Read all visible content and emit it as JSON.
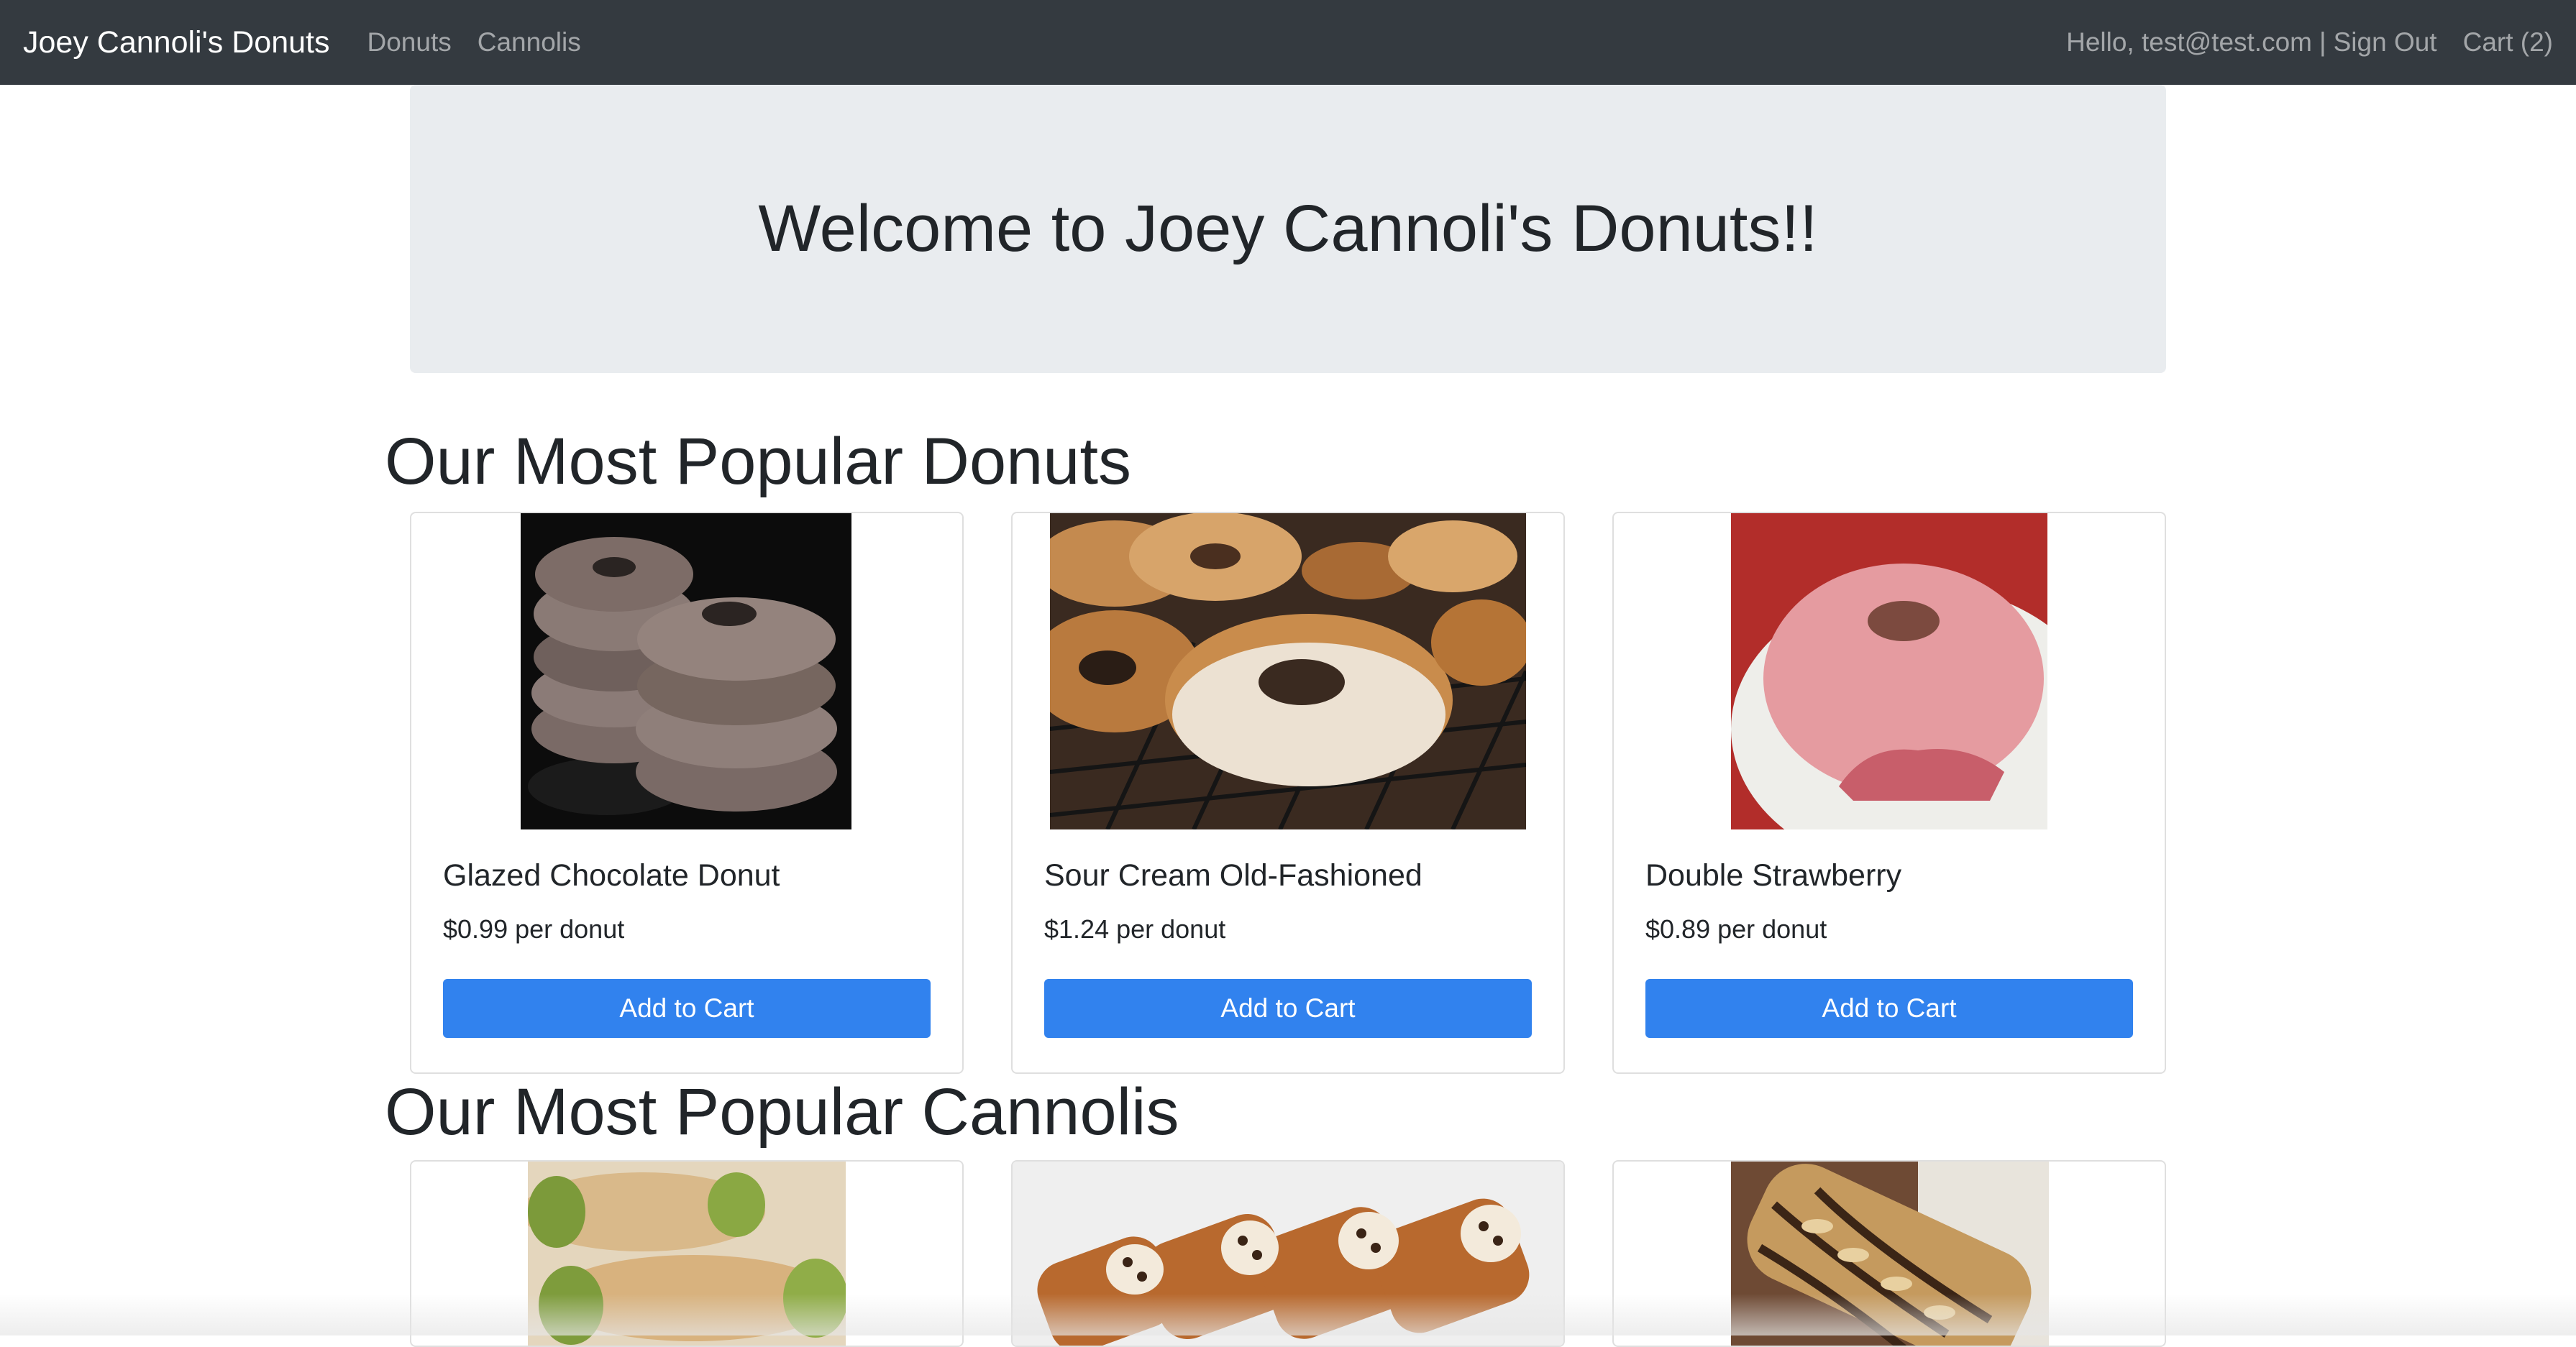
{
  "navbar": {
    "brand": "Joey Cannoli's Donuts",
    "links": [
      "Donuts",
      "Cannolis"
    ],
    "greeting": "Hello, test@test.com",
    "separator": "|",
    "sign_out": "Sign Out",
    "cart": "Cart (2)"
  },
  "jumbotron": {
    "heading": "Welcome to Joey Cannoli's Donuts!!"
  },
  "donuts": {
    "title": "Our Most Popular Donuts",
    "items": [
      {
        "name": "Glazed Chocolate Donut",
        "price": "$0.99 per donut",
        "button": "Add to Cart",
        "image": "chocolate-donut-stack-photo"
      },
      {
        "name": "Sour Cream Old-Fashioned",
        "price": "$1.24 per donut",
        "button": "Add to Cart",
        "image": "old-fashioned-donuts-on-rack-photo"
      },
      {
        "name": "Double Strawberry",
        "price": "$0.89 per donut",
        "button": "Add to Cart",
        "image": "strawberry-donut-bitten-photo"
      }
    ]
  },
  "cannolis": {
    "title": "Our Most Popular Cannolis",
    "items": [
      {
        "image": "pistachio-cannoli-photo"
      },
      {
        "image": "chocolate-chip-cannolis-photo"
      },
      {
        "image": "almond-chocolate-cannoli-photo"
      }
    ]
  },
  "colors": {
    "navbar": "#343a40",
    "jumbotron": "#e9ecef",
    "button": "#3182ee"
  }
}
